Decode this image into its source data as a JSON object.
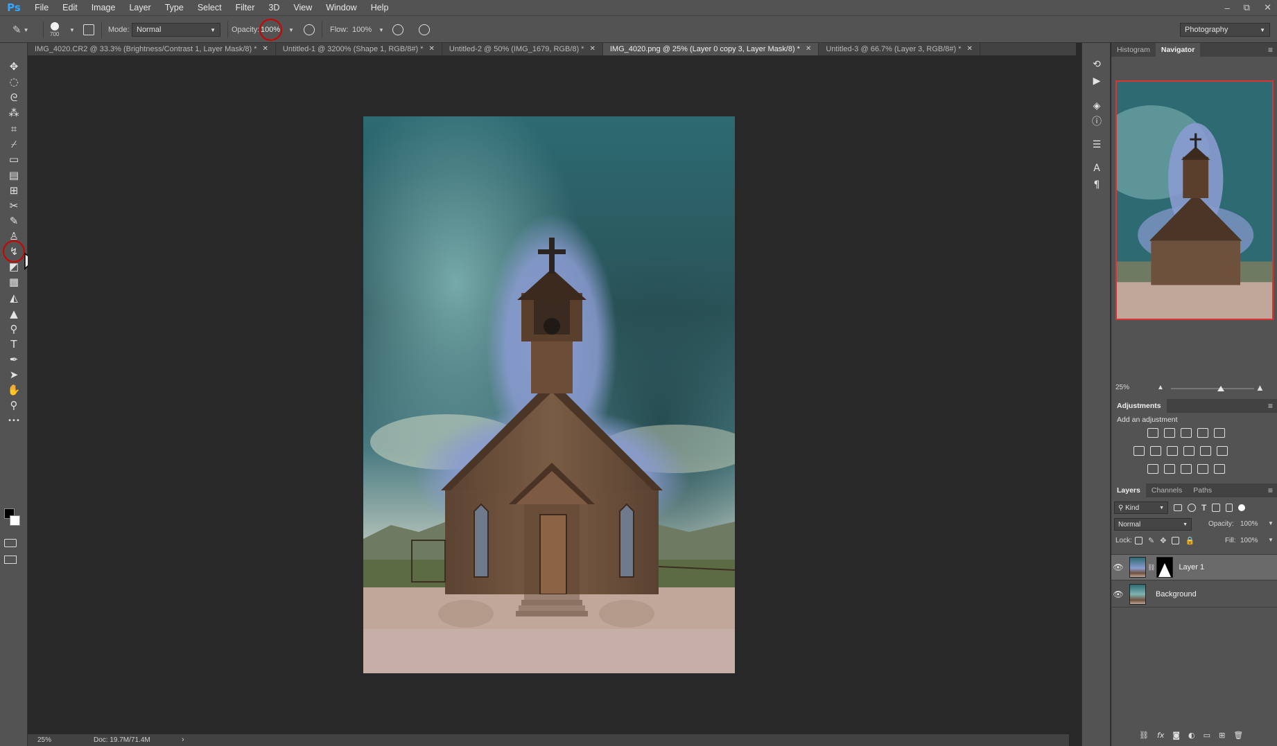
{
  "app": {
    "logo": "Ps"
  },
  "menu": [
    "File",
    "Edit",
    "Image",
    "Layer",
    "Type",
    "Select",
    "Filter",
    "3D",
    "View",
    "Window",
    "Help"
  ],
  "window_controls": [
    "–",
    "⧉",
    "✕"
  ],
  "options": {
    "brush_size": "700",
    "mode_label": "Mode:",
    "mode_value": "Normal",
    "opacity_label": "Opacity:",
    "opacity_value": "100%",
    "flow_label": "Flow:",
    "flow_value": "100%",
    "workspace": "Photography"
  },
  "tabs": [
    {
      "label": "IMG_4020.CR2 @ 33.3% (Brightness/Contrast 1, Layer Mask/8) *",
      "active": false
    },
    {
      "label": "Untitled-1 @ 3200% (Shape 1, RGB/8#) *",
      "active": false
    },
    {
      "label": "Untitled-2 @ 50% (IMG_1679, RGB/8) *",
      "active": false
    },
    {
      "label": "IMG_4020.png @ 25% (Layer 0 copy 3, Layer Mask/8) *",
      "active": true
    },
    {
      "label": "Untitled-3 @ 66.7% (Layer 3, RGB/8#) *",
      "active": false
    }
  ],
  "tab_close": "✕",
  "tools": [
    {
      "name": "move-tool-icon",
      "glyph": "✥"
    },
    {
      "name": "marquee-tool-icon",
      "glyph": "◌"
    },
    {
      "name": "lasso-tool-icon",
      "glyph": "ᘓ"
    },
    {
      "name": "magic-wand-tool-icon",
      "glyph": "⁂"
    },
    {
      "name": "crop-tool-icon",
      "glyph": "⌗"
    },
    {
      "name": "eyedropper-tool-icon",
      "glyph": "⌿"
    },
    {
      "name": "spot-healing-tool-icon",
      "glyph": "▭"
    },
    {
      "name": "healing-tool-icon",
      "glyph": "▤"
    },
    {
      "name": "patch-tool-icon",
      "glyph": "⊞"
    },
    {
      "name": "content-aware-move-icon",
      "glyph": "✂"
    },
    {
      "name": "brush-tool-icon",
      "glyph": "✎"
    },
    {
      "name": "clone-stamp-tool-icon",
      "glyph": "♙"
    },
    {
      "name": "history-brush-tool-icon",
      "glyph": "↯"
    },
    {
      "name": "eraser-tool-icon",
      "glyph": "◩"
    },
    {
      "name": "gradient-tool-icon",
      "glyph": "▦"
    },
    {
      "name": "blur-tool-icon",
      "glyph": "◭"
    },
    {
      "name": "sharpen-tool-icon",
      "glyph": "▲"
    },
    {
      "name": "dodge-tool-icon",
      "glyph": "⚲"
    },
    {
      "name": "type-tool-icon",
      "glyph": "T"
    },
    {
      "name": "pen-tool-icon",
      "glyph": "✒"
    },
    {
      "name": "path-selection-tool-icon",
      "glyph": "➤"
    },
    {
      "name": "hand-tool-icon",
      "glyph": "✋"
    },
    {
      "name": "zoom-tool-icon",
      "glyph": "⚲"
    },
    {
      "name": "more-tools-icon",
      "glyph": "•••"
    }
  ],
  "right_column_icons": [
    {
      "name": "history-panel-icon",
      "glyph": "⟲"
    },
    {
      "name": "actions-panel-icon",
      "glyph": "▶"
    },
    {
      "name": "properties-panel-icon",
      "glyph": "◈"
    },
    {
      "name": "info-panel-icon",
      "glyph": "ⓘ"
    },
    {
      "name": "tool-presets-panel-icon",
      "glyph": "☰"
    },
    {
      "name": "character-panel-icon",
      "glyph": "A"
    },
    {
      "name": "paragraph-panel-icon",
      "glyph": "¶"
    }
  ],
  "navigator": {
    "tabs": [
      "Histogram",
      "Navigator"
    ],
    "active_tab": "Navigator",
    "zoom": "25%",
    "slider_fraction": 0.6
  },
  "adjustments": {
    "tab": "Adjustments",
    "subtitle": "Add an adjustment"
  },
  "layers_panel": {
    "tabs": [
      "Layers",
      "Channels",
      "Paths"
    ],
    "active_tab": "Layers",
    "filter": "Kind",
    "blend_mode": "Normal",
    "opacity_label": "Opacity:",
    "opacity_value": "100%",
    "lock_label": "Lock:",
    "fill_label": "Fill:",
    "fill_value": "100%",
    "layers": [
      {
        "name": "Layer 1",
        "selected": true,
        "has_mask": true
      },
      {
        "name": "Background",
        "selected": false,
        "has_mask": false
      }
    ]
  },
  "status": {
    "zoom": "25%",
    "doc": "Doc: 19.7M/71.4M"
  },
  "colors": {
    "ui_dark": "#535353",
    "canvas_bg": "#282828",
    "highlight_ring": "#d00000",
    "sky_teal": "#2f6e74",
    "halo_blue": "#8093c8"
  }
}
